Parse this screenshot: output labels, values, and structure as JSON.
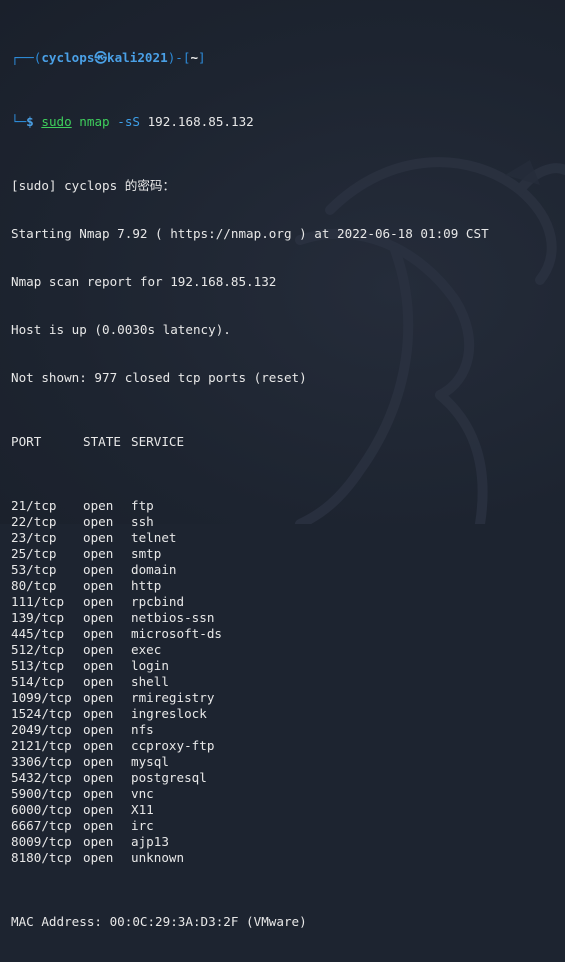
{
  "prompt": {
    "user": "cyclops",
    "at_symbol": "㉿",
    "host": "kali2021",
    "cwd": "~",
    "dollar": "$",
    "cmd_sudo": "sudo",
    "cmd_nmap": "nmap",
    "cmd_flag": "-sS",
    "cmd_target": "192.168.85.132"
  },
  "output": {
    "sudo_prompt": "[sudo] cyclops 的密码：",
    "starting": "Starting Nmap 7.92 ( https://nmap.org ) at 2022-06-18 01:09 CST",
    "report": "Nmap scan report for 192.168.85.132",
    "host_up": "Host is up (0.0030s latency).",
    "not_shown": "Not shown: 977 closed tcp ports (reset)",
    "header": {
      "port": "PORT",
      "state": "STATE",
      "service": "SERVICE"
    },
    "ports": [
      {
        "port": "21/tcp",
        "state": "open",
        "service": "ftp"
      },
      {
        "port": "22/tcp",
        "state": "open",
        "service": "ssh"
      },
      {
        "port": "23/tcp",
        "state": "open",
        "service": "telnet"
      },
      {
        "port": "25/tcp",
        "state": "open",
        "service": "smtp"
      },
      {
        "port": "53/tcp",
        "state": "open",
        "service": "domain"
      },
      {
        "port": "80/tcp",
        "state": "open",
        "service": "http"
      },
      {
        "port": "111/tcp",
        "state": "open",
        "service": "rpcbind"
      },
      {
        "port": "139/tcp",
        "state": "open",
        "service": "netbios-ssn"
      },
      {
        "port": "445/tcp",
        "state": "open",
        "service": "microsoft-ds"
      },
      {
        "port": "512/tcp",
        "state": "open",
        "service": "exec"
      },
      {
        "port": "513/tcp",
        "state": "open",
        "service": "login"
      },
      {
        "port": "514/tcp",
        "state": "open",
        "service": "shell"
      },
      {
        "port": "1099/tcp",
        "state": "open",
        "service": "rmiregistry"
      },
      {
        "port": "1524/tcp",
        "state": "open",
        "service": "ingreslock"
      },
      {
        "port": "2049/tcp",
        "state": "open",
        "service": "nfs"
      },
      {
        "port": "2121/tcp",
        "state": "open",
        "service": "ccproxy-ftp"
      },
      {
        "port": "3306/tcp",
        "state": "open",
        "service": "mysql"
      },
      {
        "port": "5432/tcp",
        "state": "open",
        "service": "postgresql"
      },
      {
        "port": "5900/tcp",
        "state": "open",
        "service": "vnc"
      },
      {
        "port": "6000/tcp",
        "state": "open",
        "service": "X11"
      },
      {
        "port": "6667/tcp",
        "state": "open",
        "service": "irc"
      },
      {
        "port": "8009/tcp",
        "state": "open",
        "service": "ajp13"
      },
      {
        "port": "8180/tcp",
        "state": "open",
        "service": "unknown"
      }
    ],
    "mac": "MAC Address: 00:0C:29:3A:D3:2F (VMware)"
  },
  "colors": {
    "background": "#1d2430",
    "prompt_frame": "#2d8bd8",
    "prompt_user": "#4aa0e6",
    "command": "#3ecf5c",
    "text": "#e8e8e8"
  },
  "icons": {
    "background": "kali-dragon-watermark-icon"
  }
}
